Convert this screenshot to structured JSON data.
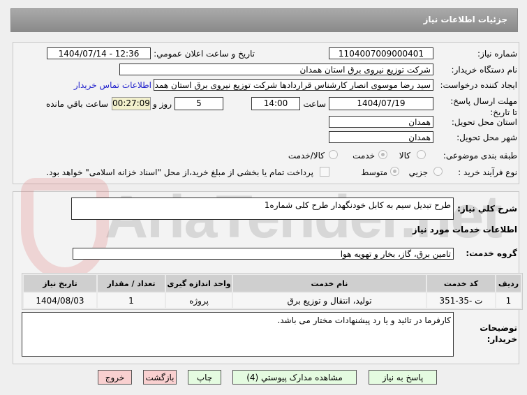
{
  "header": {
    "title": "جزئیات اطلاعات نیاز"
  },
  "form": {
    "need_number_label": "شماره نیاز:",
    "need_number": "1104007009000401",
    "announce_label": "تاریخ و ساعت اعلان عمومي:",
    "announce_value": "1404/07/14 - 12:36",
    "buyer_label": "نام دستگاه خريدار:",
    "buyer": "شرکت توزیع نیروی برق استان همدان",
    "creator_label": "ايجاد کننده درخواست:",
    "creator": "سید رضا موسوی انصار کارشناس قراردادها شرکت توزیع نیروی برق استان همدان",
    "contact_link": "اطلاعات تماس خريدار",
    "deadline_label": "مهلت ارسال پاسخ: تا تاریخ:",
    "deadline_date": "1404/07/19",
    "time_label": "ساعت",
    "deadline_time": "14:00",
    "days": "5",
    "days_label": "روز و",
    "remaining": "00:27:09",
    "remaining_label": "ساعت باقي مانده",
    "province_label": "استان محل تحویل:",
    "province": "همدان",
    "city_label": "شهر محل تحویل:",
    "city": "همدان",
    "category_label": "طبقه بندی موضوعی:",
    "category_options": [
      "کالا",
      "خدمت",
      "کالا/خدمت"
    ],
    "category_selected": "خدمت",
    "process_label": "نوع فرآیند خرید :",
    "process_options": [
      "جزيي",
      "متوسط"
    ],
    "process_selected": "متوسط",
    "payment_note": "پرداخت تمام یا بخشی از مبلغ خرید،از محل \"اسناد خزانه اسلامی\" خواهد بود."
  },
  "details": {
    "summary_label": "شرح كلي نياز:",
    "summary": "طرح تبدیل سیم به کابل خودنگهدار طرح کلی شماره1",
    "services_title": "اطلاعات خدمات مورد نیاز",
    "group_label": "گروه خدمت:",
    "group": "تامین برق، گاز، بخار و تهویه هوا",
    "table": {
      "headers": [
        "ردیف",
        "کد خدمت",
        "نام خدمت",
        "واحد اندازه گیری",
        "تعداد / مقدار",
        "تاریخ نیاز"
      ],
      "rows": [
        [
          "1",
          "ت -35-351",
          "تولید، انتقال و توزیع برق",
          "پروژه",
          "1",
          "1404/08/03"
        ]
      ]
    },
    "notes_label": "توضیحات خریدار:",
    "notes": "کارفرما در تائید و یا رد پیشنهادات مختار می باشد."
  },
  "buttons": {
    "reply": "پاسخ به نیاز",
    "attachments": "مشاهده مدارک پیوستي (4)",
    "print": "چاپ",
    "back": "بازگشت",
    "exit": "خروج"
  },
  "watermark": "AriaTender.net"
}
